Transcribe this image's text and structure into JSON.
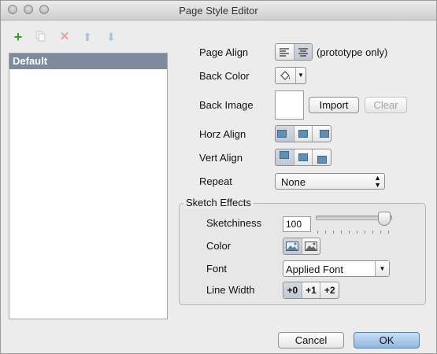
{
  "window": {
    "title": "Page Style Editor"
  },
  "toolbar": {
    "add_icon": "plus-icon",
    "duplicate_icon": "duplicate-icon",
    "delete_icon": "delete-icon",
    "move_up_icon": "arrow-up-icon",
    "move_down_icon": "arrow-down-icon"
  },
  "styles_list": {
    "items": [
      "Default"
    ]
  },
  "form": {
    "page_align_label": "Page Align",
    "page_align_note": "(prototype only)",
    "back_color_label": "Back Color",
    "back_image_label": "Back Image",
    "import_label": "Import",
    "clear_label": "Clear",
    "horz_align_label": "Horz Align",
    "vert_align_label": "Vert Align",
    "repeat_label": "Repeat",
    "repeat_value": "None"
  },
  "sketch": {
    "legend": "Sketch Effects",
    "sketchiness_label": "Sketchiness",
    "sketchiness_value": "100",
    "color_label": "Color",
    "font_label": "Font",
    "font_value": "Applied Font",
    "line_width_label": "Line Width",
    "line_width_options": [
      "+0",
      "+1",
      "+2"
    ]
  },
  "footer": {
    "cancel_label": "Cancel",
    "ok_label": "OK"
  },
  "colors": {
    "selection": "#7f8a9c",
    "add": "#3a9a2e",
    "delete_disabled": "#e7a3a3",
    "arrow_disabled": "#a9c3de"
  }
}
